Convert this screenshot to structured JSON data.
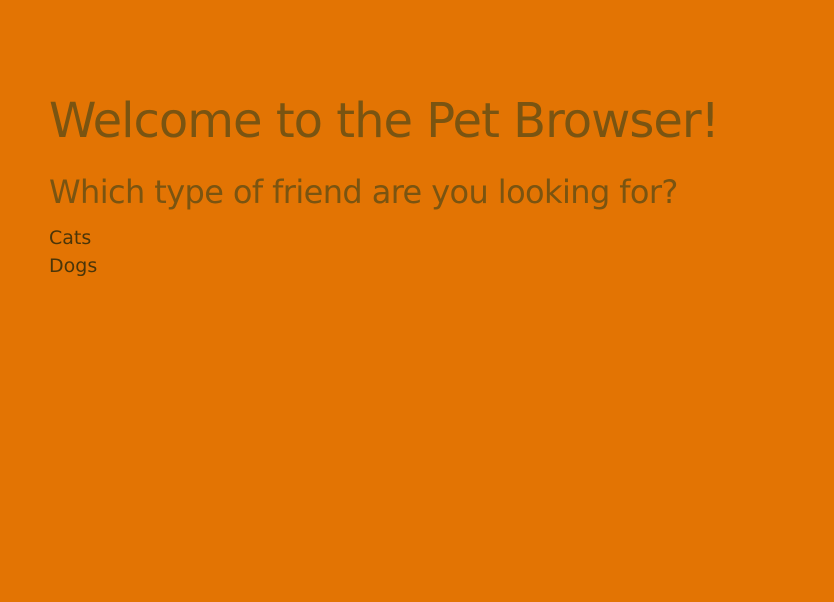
{
  "theme": {
    "background": "#E37403",
    "heading_color": "#7A5411",
    "link_color": "#4A3509"
  },
  "header": {
    "title": "Welcome to the Pet Browser!",
    "subtitle": "Which type of friend are you looking for?"
  },
  "pet_types": [
    {
      "label": "Cats"
    },
    {
      "label": "Dogs"
    }
  ]
}
